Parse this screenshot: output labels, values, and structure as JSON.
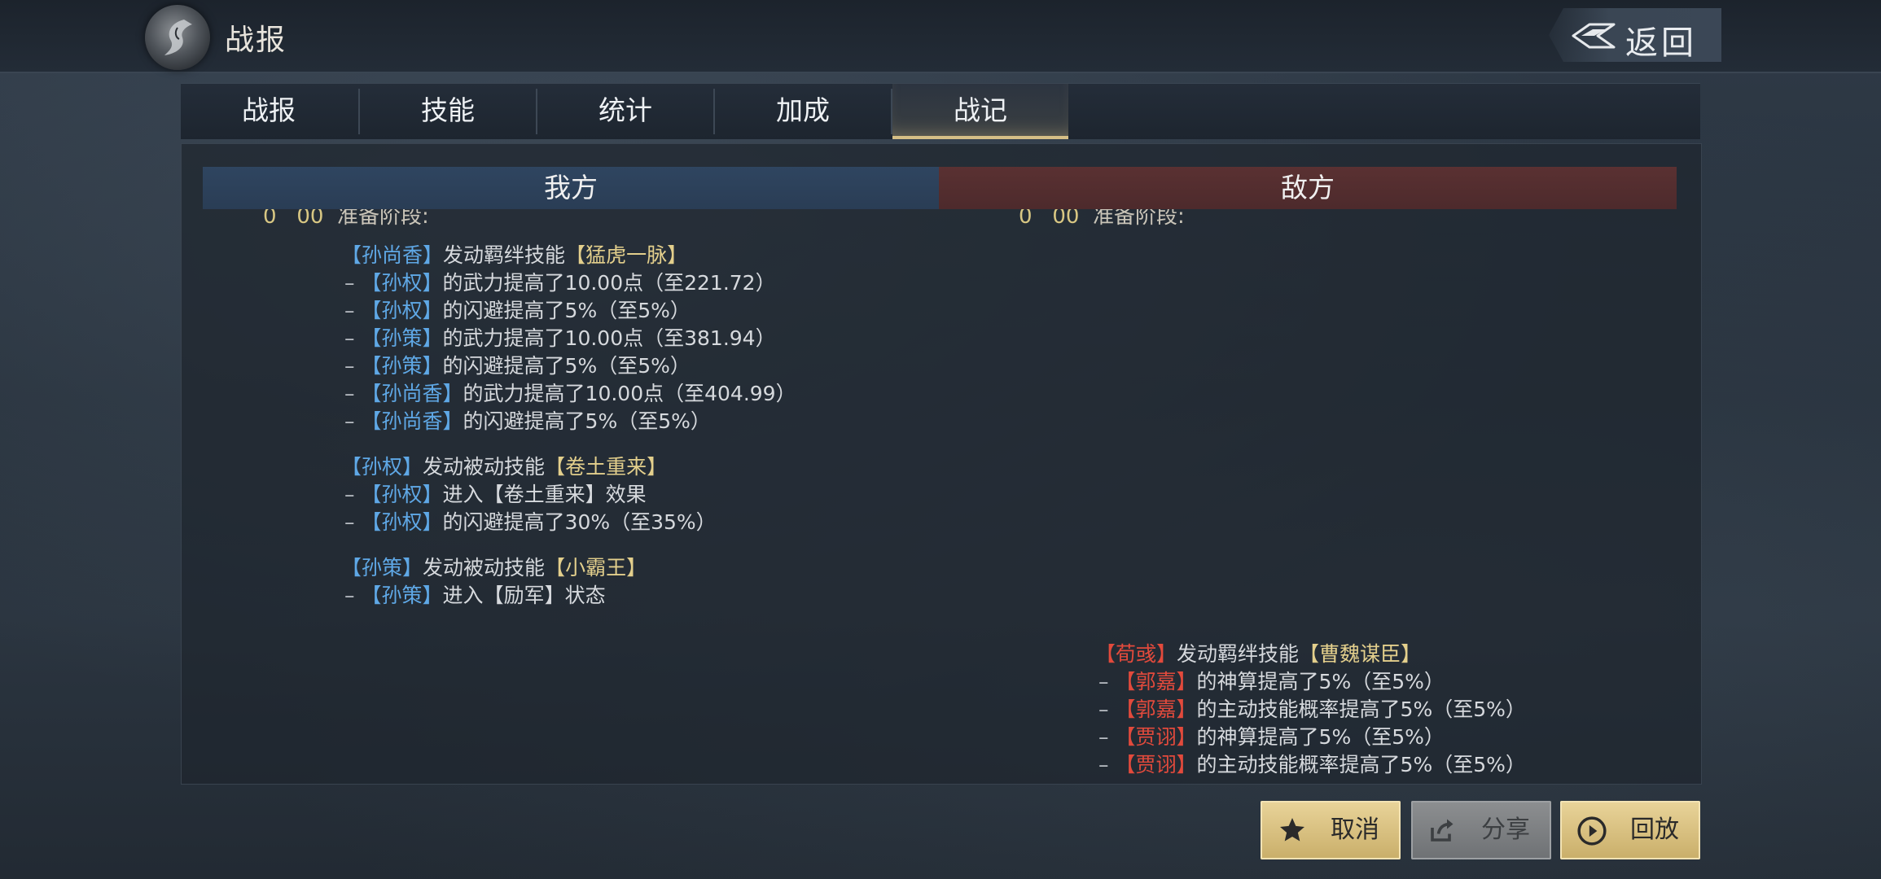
{
  "header": {
    "title": "战报",
    "back_label": "返回"
  },
  "tabs": [
    {
      "label": "战报"
    },
    {
      "label": "技能"
    },
    {
      "label": "统计"
    },
    {
      "label": "加成"
    },
    {
      "label": "战记",
      "active": true
    }
  ],
  "columns": {
    "ally": "我方",
    "enemy": "敌方"
  },
  "stage": {
    "ally_time": "0   00",
    "ally_text": "准备阶段:",
    "enemy_time": "0   00",
    "enemy_text": "准备阶段:"
  },
  "ally_log": {
    "e1": {
      "actor": "孙尚香",
      "verb": "发动羁绊技能",
      "skill": "猛虎一脉",
      "subs": [
        {
          "target": "孙权",
          "text": "的武力提高了10.00点（至221.72）"
        },
        {
          "target": "孙权",
          "text": "的闪避提高了5%（至5%）"
        },
        {
          "target": "孙策",
          "text": "的武力提高了10.00点（至381.94）"
        },
        {
          "target": "孙策",
          "text": "的闪避提高了5%（至5%）"
        },
        {
          "target": "孙尚香",
          "text": "的武力提高了10.00点（至404.99）"
        },
        {
          "target": "孙尚香",
          "text": "的闪避提高了5%（至5%）"
        }
      ]
    },
    "e2": {
      "actor": "孙权",
      "verb": "发动被动技能",
      "skill": "卷土重来",
      "subs": [
        {
          "target": "孙权",
          "pre": "进入",
          "bracket": "卷土重来",
          "post": "效果"
        },
        {
          "target": "孙权",
          "text": "的闪避提高了30%（至35%）"
        }
      ]
    },
    "e3": {
      "actor": "孙策",
      "verb": "发动被动技能",
      "skill": "小霸王",
      "subs": [
        {
          "target": "孙策",
          "pre": "进入",
          "bracket": "励军",
          "post": "状态"
        }
      ]
    }
  },
  "enemy_log": {
    "e1": {
      "actor": "荀彧",
      "verb": "发动羁绊技能",
      "skill": "曹魏谋臣",
      "subs": [
        {
          "target": "郭嘉",
          "text": "的神算提高了5%（至5%）"
        },
        {
          "target": "郭嘉",
          "text": "的主动技能概率提高了5%（至5%）"
        },
        {
          "target": "贾诩",
          "text": "的神算提高了5%（至5%）"
        },
        {
          "target": "贾诩",
          "text": "的主动技能概率提高了5%（至5%）"
        }
      ]
    }
  },
  "brackets": {
    "open": "【",
    "close": "】"
  },
  "dash": "–",
  "buttons": {
    "cancel": "取消",
    "share": "分享",
    "replay": "回放"
  },
  "icons": {
    "emblem": "dragon-emblem-icon",
    "back": "back-arrow-icon",
    "cancel": "star-icon",
    "share": "share-icon",
    "replay": "play-circle-icon"
  },
  "colors": {
    "ally_hero": "#5fa8e6",
    "enemy_hero": "#e24a3c",
    "skill_name": "#e3cf8c",
    "ally_header": "#2f4560",
    "enemy_header": "#5a3132",
    "gold_button": "#d8c07e"
  }
}
